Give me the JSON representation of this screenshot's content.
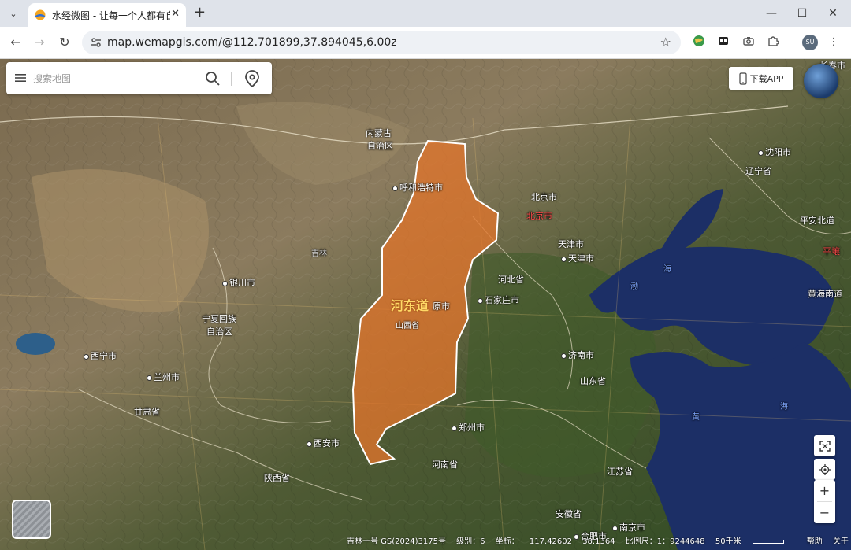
{
  "browser": {
    "tab_title": "水经微图 - 让每一个人都有自己",
    "url": "map.wemapgis.com/@112.701899,37.894045,6.00z",
    "profile_initials": "SU",
    "buttons": {
      "back": "←",
      "forward": "→",
      "reload": "↻",
      "new_tab": "+",
      "minimize": "—",
      "maximize": "☐",
      "close": "✕",
      "tab_close": "✕",
      "bookmark": "☆",
      "menu": "⋮",
      "tab_list": "⌄"
    }
  },
  "search": {
    "placeholder": "搜索地图"
  },
  "download_app": {
    "label": "下载APP"
  },
  "region": {
    "name": "河东道",
    "fill_color": "#e0742c"
  },
  "map_labels": {
    "inner_mongolia": "内蒙古",
    "inner_mongolia_2": "自治区",
    "hohhot": "呼和浩特市",
    "beijing": "北京市",
    "beijing_red": "北京市",
    "tianjin": "天津市",
    "tianjin_city": "天津市",
    "hebei": "河北省",
    "shijiazhuang": "石家庄市",
    "taiyuan": "原市",
    "shanxi": "山西省",
    "yinchuan": "银川市",
    "ningxia_1": "宁夏回族",
    "ningxia_2": "自治区",
    "xining": "西宁市",
    "lanzhou": "兰州市",
    "gansu": "甘肃省",
    "xian": "西安市",
    "shaanxi": "陕西省",
    "zhengzhou": "郑州市",
    "henan": "河南省",
    "jinan": "济南市",
    "shandong": "山东省",
    "jiangsu": "江苏省",
    "anhui": "安徽省",
    "hefei": "合肥市",
    "nanjing": "南京市",
    "shenyang": "沈阳市",
    "liaoning": "辽宁省",
    "changchun": "长春市",
    "pyongan_north": "平安北道",
    "pyongyang": "平壤",
    "south_hwanghae": "黄海南道",
    "sea_bohai_1": "渤",
    "sea_bohai_2": "海",
    "sea_yellow_1": "黄",
    "sea_yellow_2": "海",
    "river_ji": "吉林"
  },
  "status": {
    "source": "吉林一号 GS(2024)3175号",
    "level_label": "级别：6",
    "coord_label": "坐标：",
    "lng": "117.42602",
    "lat": "38.1364",
    "scale_label": "比例尺：1：9244648",
    "scale_text": "50千米",
    "help": "帮助",
    "about": "关于"
  },
  "controls": {
    "zoom_in": "+",
    "zoom_out": "−"
  }
}
